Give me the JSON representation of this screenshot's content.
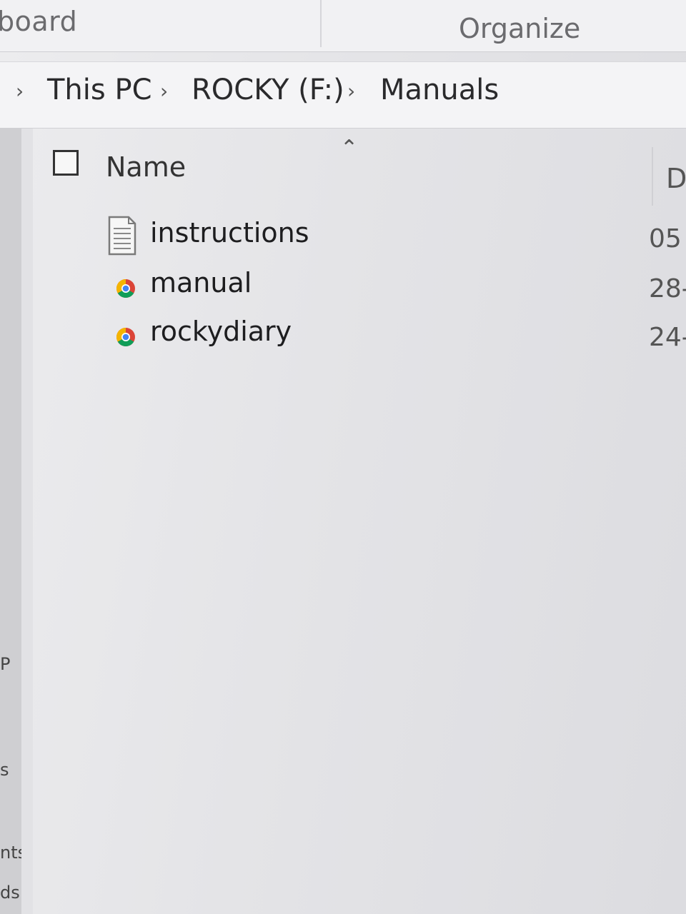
{
  "ribbon": {
    "left_group_label": "board",
    "right_group_label": "Organize"
  },
  "breadcrumb": {
    "items": [
      "This PC",
      "ROCKY (F:)",
      "Manuals"
    ]
  },
  "nav_pane": {
    "fragments": [
      "P",
      "s",
      "nts",
      "ds"
    ]
  },
  "file_list": {
    "columns": {
      "name": "Name",
      "date": "D"
    },
    "rows": [
      {
        "name": "instructions",
        "date": "05",
        "icon": "text-document-icon"
      },
      {
        "name": "manual",
        "date": "28-",
        "icon": "chrome-html-icon"
      },
      {
        "name": "rockydiary",
        "date": "24-",
        "icon": "chrome-html-icon"
      }
    ]
  },
  "colors": {
    "chrome_red": "#db4437",
    "chrome_yellow": "#f4b400",
    "chrome_green": "#0f9d58",
    "chrome_blue": "#4285f4"
  }
}
